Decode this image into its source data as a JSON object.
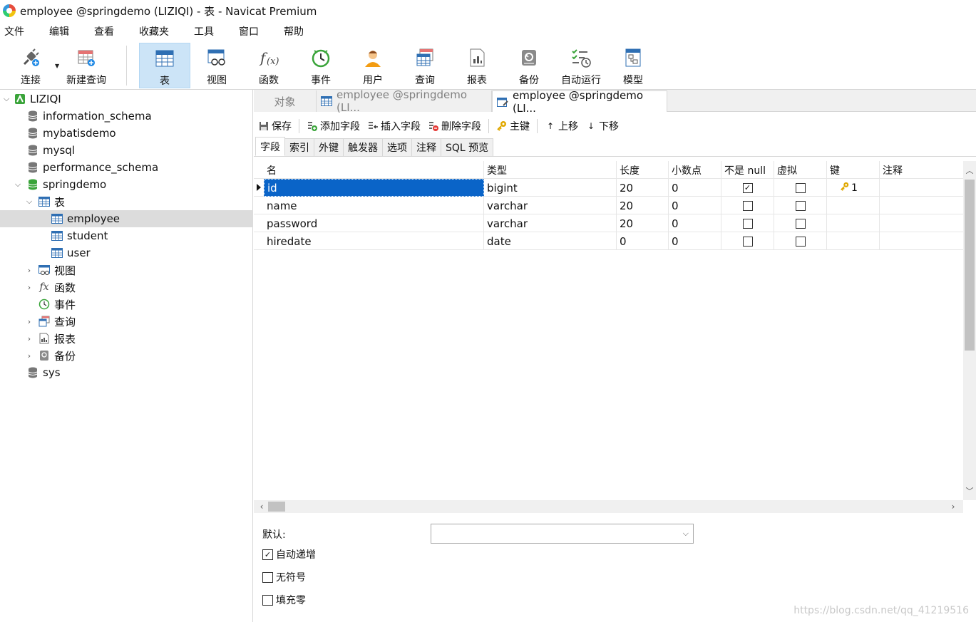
{
  "window": {
    "title": "employee @springdemo (LIZIQI) - 表 - Navicat Premium"
  },
  "menu": [
    "文件",
    "编辑",
    "查看",
    "收藏夹",
    "工具",
    "窗口",
    "帮助"
  ],
  "toolbar": {
    "buttons": [
      {
        "label": "连接",
        "icon": "plug-icon"
      },
      {
        "label": "新建查询",
        "icon": "new-query-icon"
      },
      {
        "label": "表",
        "icon": "table-icon",
        "active": true
      },
      {
        "label": "视图",
        "icon": "view-icon"
      },
      {
        "label": "函数",
        "icon": "function-icon"
      },
      {
        "label": "事件",
        "icon": "clock-icon"
      },
      {
        "label": "用户",
        "icon": "user-icon"
      },
      {
        "label": "查询",
        "icon": "query-icon"
      },
      {
        "label": "报表",
        "icon": "report-icon"
      },
      {
        "label": "备份",
        "icon": "backup-icon"
      },
      {
        "label": "自动运行",
        "icon": "automation-icon"
      },
      {
        "label": "模型",
        "icon": "model-icon"
      }
    ]
  },
  "tree": {
    "connection": "LIZIQI",
    "databases": [
      "information_schema",
      "mybatisdemo",
      "mysql",
      "performance_schema",
      "springdemo",
      "sys"
    ],
    "springdemo_groups": {
      "tables_label": "表",
      "tables": [
        "employee",
        "student",
        "user"
      ],
      "others": [
        "视图",
        "函数",
        "事件",
        "查询",
        "报表",
        "备份"
      ]
    },
    "selected": "employee"
  },
  "tabs": {
    "objects": "对象",
    "tab1": "employee @springdemo (LI...",
    "tab2": "employee @springdemo (LI..."
  },
  "actions": {
    "save": "保存",
    "add_field": "添加字段",
    "insert_field": "插入字段",
    "delete_field": "删除字段",
    "primary_key": "主键",
    "move_up": "上移",
    "move_down": "下移"
  },
  "subtabs": [
    "字段",
    "索引",
    "外键",
    "触发器",
    "选项",
    "注释",
    "SQL 预览"
  ],
  "grid": {
    "columns": [
      "名",
      "类型",
      "长度",
      "小数点",
      "不是 null",
      "虚拟",
      "键",
      "注释"
    ],
    "rows": [
      {
        "name": "id",
        "type": "bigint",
        "length": "20",
        "decimals": "0",
        "not_null": true,
        "virtual": false,
        "key": "1"
      },
      {
        "name": "name",
        "type": "varchar",
        "length": "20",
        "decimals": "0",
        "not_null": false,
        "virtual": false,
        "key": ""
      },
      {
        "name": "password",
        "type": "varchar",
        "length": "20",
        "decimals": "0",
        "not_null": false,
        "virtual": false,
        "key": ""
      },
      {
        "name": "hiredate",
        "type": "date",
        "length": "0",
        "decimals": "0",
        "not_null": false,
        "virtual": false,
        "key": ""
      }
    ]
  },
  "properties": {
    "default_label": "默认:",
    "default_value": "",
    "auto_increment": {
      "label": "自动递增",
      "checked": true
    },
    "unsigned": {
      "label": "无符号",
      "checked": false
    },
    "zerofill": {
      "label": "填充零",
      "checked": false
    }
  },
  "watermark": "https://blog.csdn.net/qq_41219516",
  "colors": {
    "accent": "#0a64c8",
    "active_toolbar": "#cce4f7",
    "db_green": "#3aa43a"
  }
}
